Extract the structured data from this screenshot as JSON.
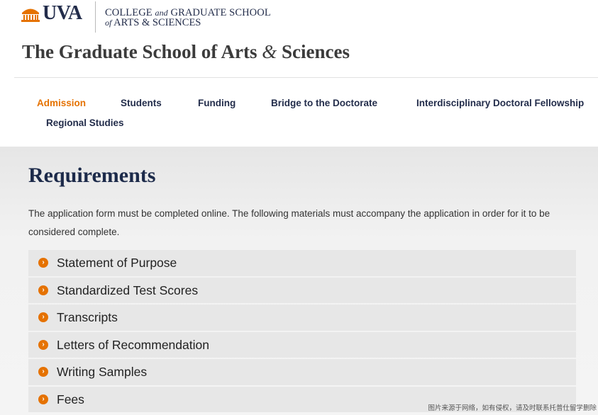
{
  "header": {
    "logo_text": "UVA",
    "college_line1_a": "COLLEGE ",
    "college_line1_and": "and",
    "college_line1_b": " GRADUATE SCHOOL",
    "college_line2_of": "of",
    "college_line2_b": " ARTS & SCIENCES",
    "site_title_a": "The Graduate School of Arts ",
    "site_title_amp": "&",
    "site_title_b": " Sciences"
  },
  "nav": {
    "admission": "Admission",
    "students": "Students",
    "funding": "Funding",
    "bridge": "Bridge to the Doctorate",
    "interdisciplinary": "Interdisciplinary Doctoral Fellowship",
    "regional": "Regional Studies",
    "active": "Admission"
  },
  "main": {
    "title": "Requirements",
    "intro": "The application form must be completed online.  The following materials must accompany the application in order for it to be considered complete.",
    "requirements": [
      "Statement of Purpose",
      "Standardized Test Scores",
      "Transcripts",
      "Letters of Recommendation",
      "Writing Samples",
      "Fees"
    ],
    "bullet_icon": "arrow-right-circle-icon"
  },
  "watermark": "图片来源于网络，如有侵权，请及时联系托普仕留学删除",
  "colors": {
    "brand_orange": "#E57200",
    "brand_navy": "#232D4B"
  }
}
